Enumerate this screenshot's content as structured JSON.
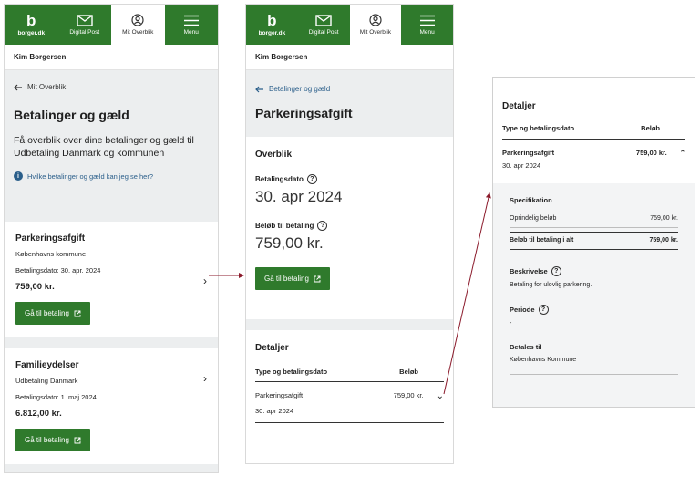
{
  "nav": {
    "logo_letter": "b",
    "logo_text": "borger.dk",
    "digital_post": "Digital Post",
    "mit_overblik": "Mit Overblik",
    "menu": "Menu"
  },
  "user_name": "Kim Borgersen",
  "screen1": {
    "back_label": "Mit Overblik",
    "title": "Betalinger og gæld",
    "lead": "Få overblik over dine betalinger og gæld til Udbetaling Danmark og kommunen",
    "help_link": "Hvilke betalinger og gæld kan jeg se her?",
    "cards": [
      {
        "title": "Parkeringsafgift",
        "issuer": "Københavns kommune",
        "date": "Betalingsdato: 30. apr. 2024",
        "amount": "759,00 kr.",
        "button": "Gå til betaling"
      },
      {
        "title": "Familieydelser",
        "issuer": "Udbetaling Danmark",
        "date": "Betalingsdato: 1. maj 2024",
        "amount": "6.812,00 kr.",
        "button": "Gå til betaling"
      }
    ]
  },
  "screen2": {
    "back_label": "Betalinger og gæld",
    "title": "Parkeringsafgift",
    "overview_title": "Overblik",
    "payment_date_label": "Betalingsdato",
    "payment_date_value": "30. apr 2024",
    "amount_label": "Beløb til betaling",
    "amount_value": "759,00 kr.",
    "button": "Gå til betaling",
    "details_title": "Detaljer",
    "col_type": "Type og betalingsdato",
    "col_amount": "Beløb",
    "row_title": "Parkeringsafgift",
    "row_amount": "759,00 kr.",
    "row_date": "30. apr 2024"
  },
  "screen3": {
    "title": "Detaljer",
    "col_type": "Type og betalingsdato",
    "col_amount": "Beløb",
    "row_title": "Parkeringsafgift",
    "row_amount": "759,00 kr.",
    "row_date": "30. apr 2024",
    "spec_title": "Specifikation",
    "orig_label": "Oprindelig beløb",
    "orig_value": "759,00 kr.",
    "total_label": "Beløb til betaling i alt",
    "total_value": "759,00 kr.",
    "desc_label": "Beskrivelse",
    "desc_value": "Betaling for ulovlig parkering.",
    "period_label": "Periode",
    "period_value": "-",
    "payee_label": "Betales til",
    "payee_value": "Københavns Kommune"
  },
  "colors": {
    "brand_green": "#2f7a2c",
    "link_blue": "#2a5e8a",
    "arrow_red": "#8b1a2b"
  }
}
